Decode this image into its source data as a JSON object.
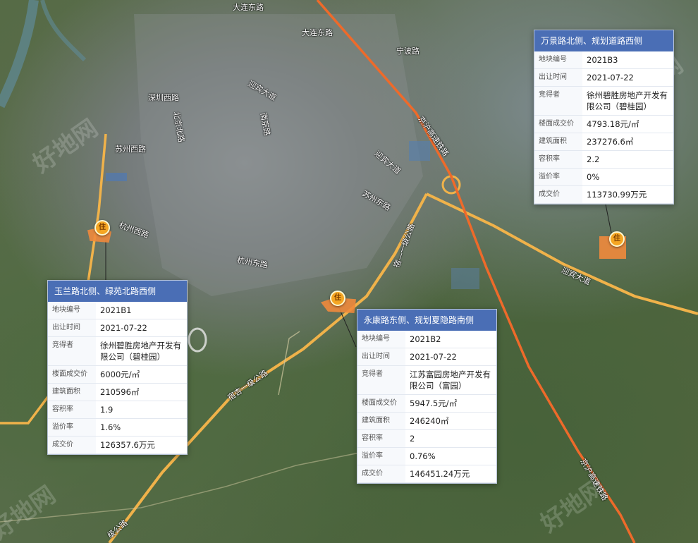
{
  "roads": [
    {
      "id": "dalian",
      "name": "大连东路"
    },
    {
      "id": "ningbo",
      "name": "宁波路"
    },
    {
      "id": "shenzhen",
      "name": "深圳西路"
    },
    {
      "id": "beijingbei",
      "name": "北京北路"
    },
    {
      "id": "suzhouxi",
      "name": "苏州西路"
    },
    {
      "id": "yingbin1",
      "name": "迎宾大道"
    },
    {
      "id": "nanjing",
      "name": "南京路"
    },
    {
      "id": "yingbin2",
      "name": "迎宾大道"
    },
    {
      "id": "suzhoudong",
      "name": "苏州东路"
    },
    {
      "id": "jingbeng1",
      "name": "京沪高速铁路"
    },
    {
      "id": "hangzhouxi",
      "name": "杭州西路"
    },
    {
      "id": "hangzhoudong",
      "name": "杭州东路"
    },
    {
      "id": "yijigongluN",
      "name": "宿—一级公路"
    },
    {
      "id": "yingbin3",
      "name": "迎宾大道"
    },
    {
      "id": "yijigongluS",
      "name": "宿杏一级公路"
    },
    {
      "id": "yijiS2",
      "name": "级公路"
    },
    {
      "id": "jingbeng2",
      "name": "京沪高速铁路"
    }
  ],
  "pins": [
    {
      "id": "p1",
      "label": "住"
    },
    {
      "id": "p2",
      "label": "住"
    },
    {
      "id": "p3",
      "label": "住"
    }
  ],
  "popups": [
    {
      "id": "b3",
      "title": "万景路北侧、规划道路西侧",
      "rows": [
        {
          "k": "地块编号",
          "v": "2021B3"
        },
        {
          "k": "出让时间",
          "v": "2021-07-22"
        },
        {
          "k": "竞得者",
          "v": "徐州碧胜房地产开发有限公司（碧桂园）"
        },
        {
          "k": "楼面成交价",
          "v": "4793.18元/㎡"
        },
        {
          "k": "建筑面积",
          "v": "237276.6㎡"
        },
        {
          "k": "容积率",
          "v": "2.2"
        },
        {
          "k": "溢价率",
          "v": "0%"
        },
        {
          "k": "成交价",
          "v": "113730.99万元"
        }
      ]
    },
    {
      "id": "b1",
      "title": "玉兰路北侧、绿苑北路西侧",
      "rows": [
        {
          "k": "地块编号",
          "v": "2021B1"
        },
        {
          "k": "出让时间",
          "v": "2021-07-22"
        },
        {
          "k": "竞得者",
          "v": "徐州碧胜房地产开发有限公司（碧桂园）"
        },
        {
          "k": "楼面成交价",
          "v": "6000元/㎡"
        },
        {
          "k": "建筑面积",
          "v": "210596㎡"
        },
        {
          "k": "容积率",
          "v": "1.9"
        },
        {
          "k": "溢价率",
          "v": "1.6%"
        },
        {
          "k": "成交价",
          "v": "126357.6万元"
        }
      ]
    },
    {
      "id": "b2",
      "title": "永康路东侧、规划夏隐路南侧",
      "rows": [
        {
          "k": "地块编号",
          "v": "2021B2"
        },
        {
          "k": "出让时间",
          "v": "2021-07-22"
        },
        {
          "k": "竞得者",
          "v": "江苏富园房地产开发有限公司（富园）"
        },
        {
          "k": "楼面成交价",
          "v": "5947.5元/㎡"
        },
        {
          "k": "建筑面积",
          "v": "246240㎡"
        },
        {
          "k": "容积率",
          "v": "2"
        },
        {
          "k": "溢价率",
          "v": "0.76%"
        },
        {
          "k": "成交价",
          "v": "146451.24万元"
        }
      ]
    }
  ],
  "colors": {
    "road": "#f0b24a",
    "rail": "#ee6a2a",
    "popup_header": "#4a6eb5",
    "parcel": "#f08a3c",
    "pin": "#f5a623"
  }
}
